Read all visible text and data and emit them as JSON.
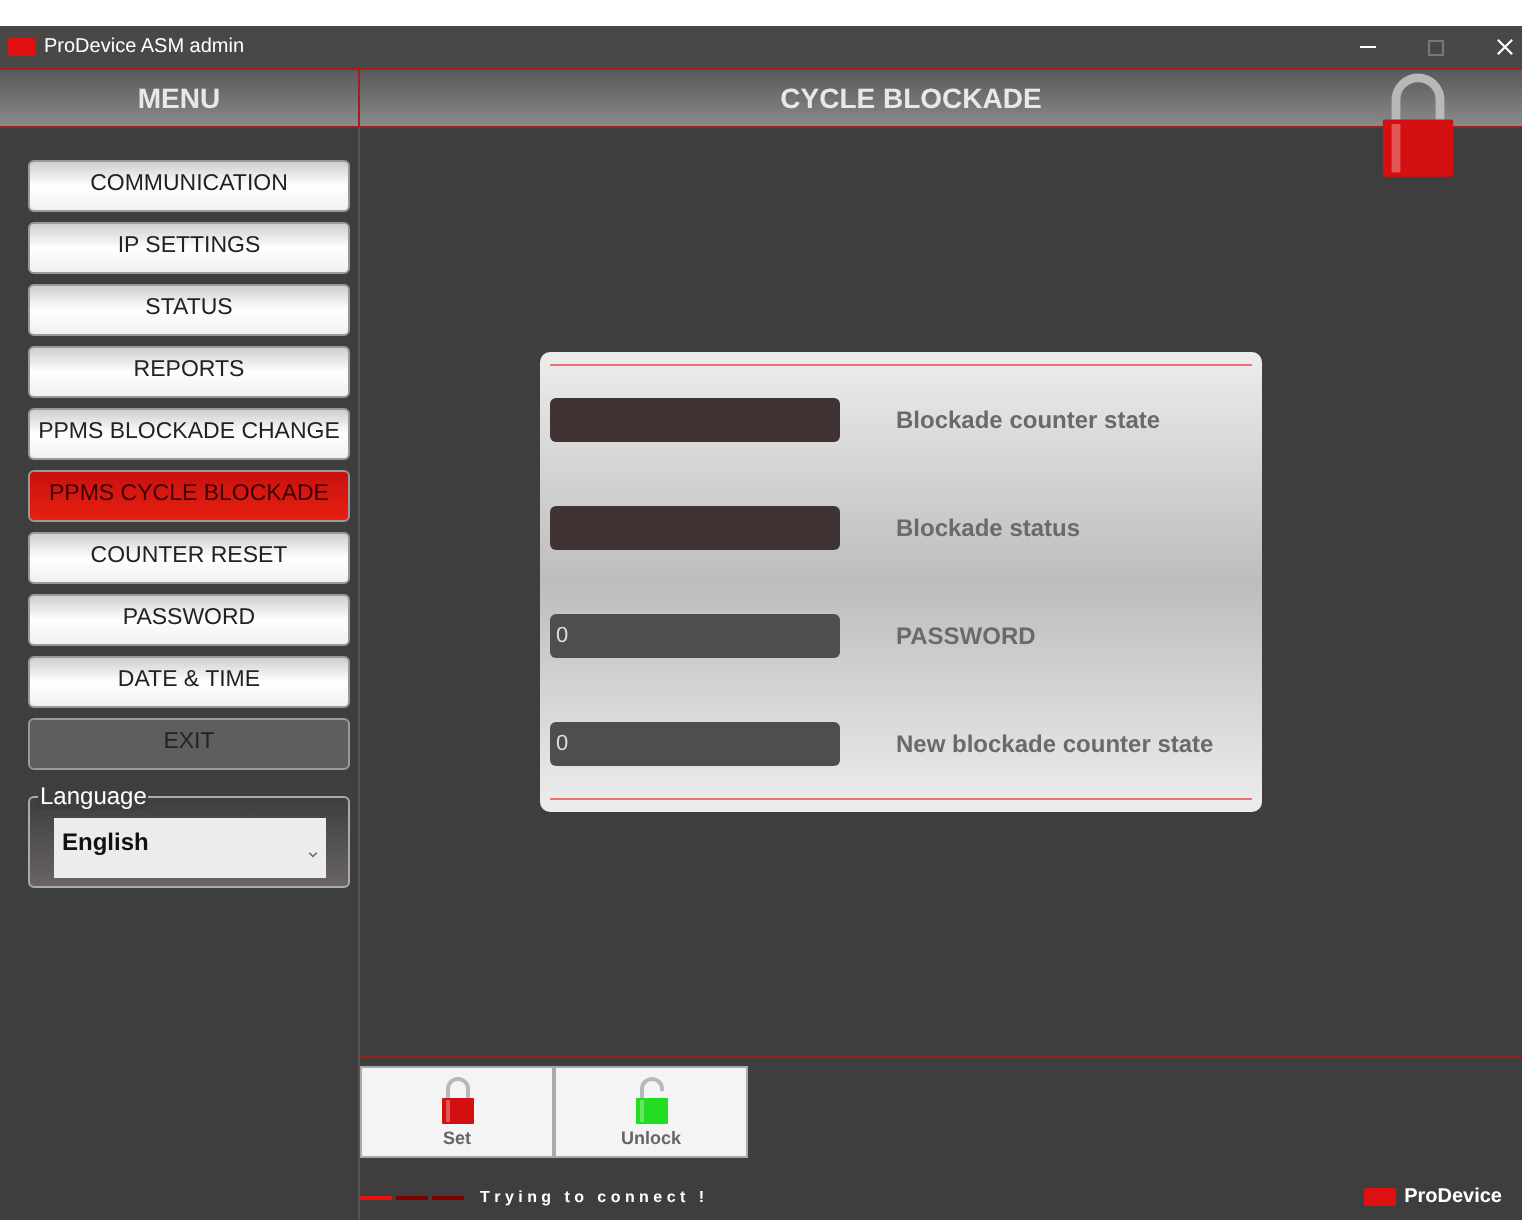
{
  "window": {
    "title": "ProDevice ASM admin"
  },
  "menu": {
    "title": "MENU",
    "items": [
      {
        "label": "COMMUNICATION",
        "selected": false,
        "kind": "nav"
      },
      {
        "label": "IP SETTINGS",
        "selected": false,
        "kind": "nav"
      },
      {
        "label": "STATUS",
        "selected": false,
        "kind": "nav"
      },
      {
        "label": "REPORTS",
        "selected": false,
        "kind": "nav"
      },
      {
        "label": "PPMS BLOCKADE CHANGE",
        "selected": false,
        "kind": "nav"
      },
      {
        "label": "PPMS CYCLE BLOCKADE",
        "selected": true,
        "kind": "nav"
      },
      {
        "label": "COUNTER RESET",
        "selected": false,
        "kind": "nav"
      },
      {
        "label": "PASSWORD",
        "selected": false,
        "kind": "nav"
      },
      {
        "label": "DATE & TIME",
        "selected": false,
        "kind": "nav"
      },
      {
        "label": "EXIT",
        "selected": false,
        "kind": "exit"
      }
    ]
  },
  "language": {
    "label": "Language",
    "value": "English"
  },
  "page": {
    "title": "CYCLE BLOCKADE",
    "locked": true
  },
  "fields": [
    {
      "label": "Blockade counter state",
      "kind": "readout"
    },
    {
      "label": "Blockade status",
      "kind": "readout"
    },
    {
      "label": "PASSWORD",
      "kind": "input",
      "value": "0"
    },
    {
      "label": "New blockade counter state",
      "kind": "input",
      "value": "0"
    }
  ],
  "actions": [
    {
      "label": "Set",
      "kind": "lock"
    },
    {
      "label": "Unlock",
      "kind": "unlock"
    }
  ],
  "status": {
    "text": "T r y i n g   t o   c o n n e c t   !",
    "level": 0.33
  },
  "brand": "ProDevice"
}
